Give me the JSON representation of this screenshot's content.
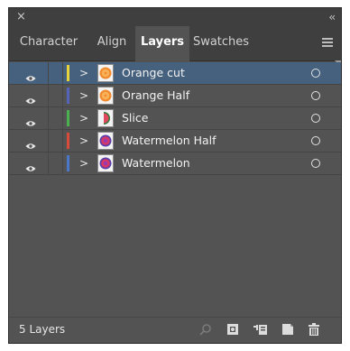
{
  "panel": {
    "tabs": [
      {
        "label": "Character",
        "active": false
      },
      {
        "label": "Align",
        "active": false
      },
      {
        "label": "Layers",
        "active": true
      },
      {
        "label": "Swatches",
        "active": false
      }
    ],
    "layers": [
      {
        "name": "Orange cut",
        "color": "#e8d33a",
        "thumbnail": "orange-thumbnail",
        "selected": true
      },
      {
        "name": "Orange Half",
        "color": "#5464b8",
        "thumbnail": "orange-thumbnail",
        "selected": false
      },
      {
        "name": "Slice",
        "color": "#4bb04e",
        "thumbnail": "watermelon-slice-thumbnail",
        "selected": false
      },
      {
        "name": "Watermelon Half",
        "color": "#d84a3a",
        "thumbnail": "watermelon-thumbnail",
        "selected": false
      },
      {
        "name": "Watermelon",
        "color": "#4a77c8",
        "thumbnail": "watermelon-thumbnail",
        "selected": false
      }
    ],
    "footer": {
      "layer_count": "5 Layers",
      "buttons": [
        "locate-object-icon",
        "make-clipping-mask-icon",
        "create-sublayer-icon",
        "create-new-layer-icon",
        "trash-icon"
      ]
    },
    "colors": {
      "panel_bg": "#535353",
      "selection": "#46617e",
      "header_bg": "#3f3f3f"
    }
  }
}
